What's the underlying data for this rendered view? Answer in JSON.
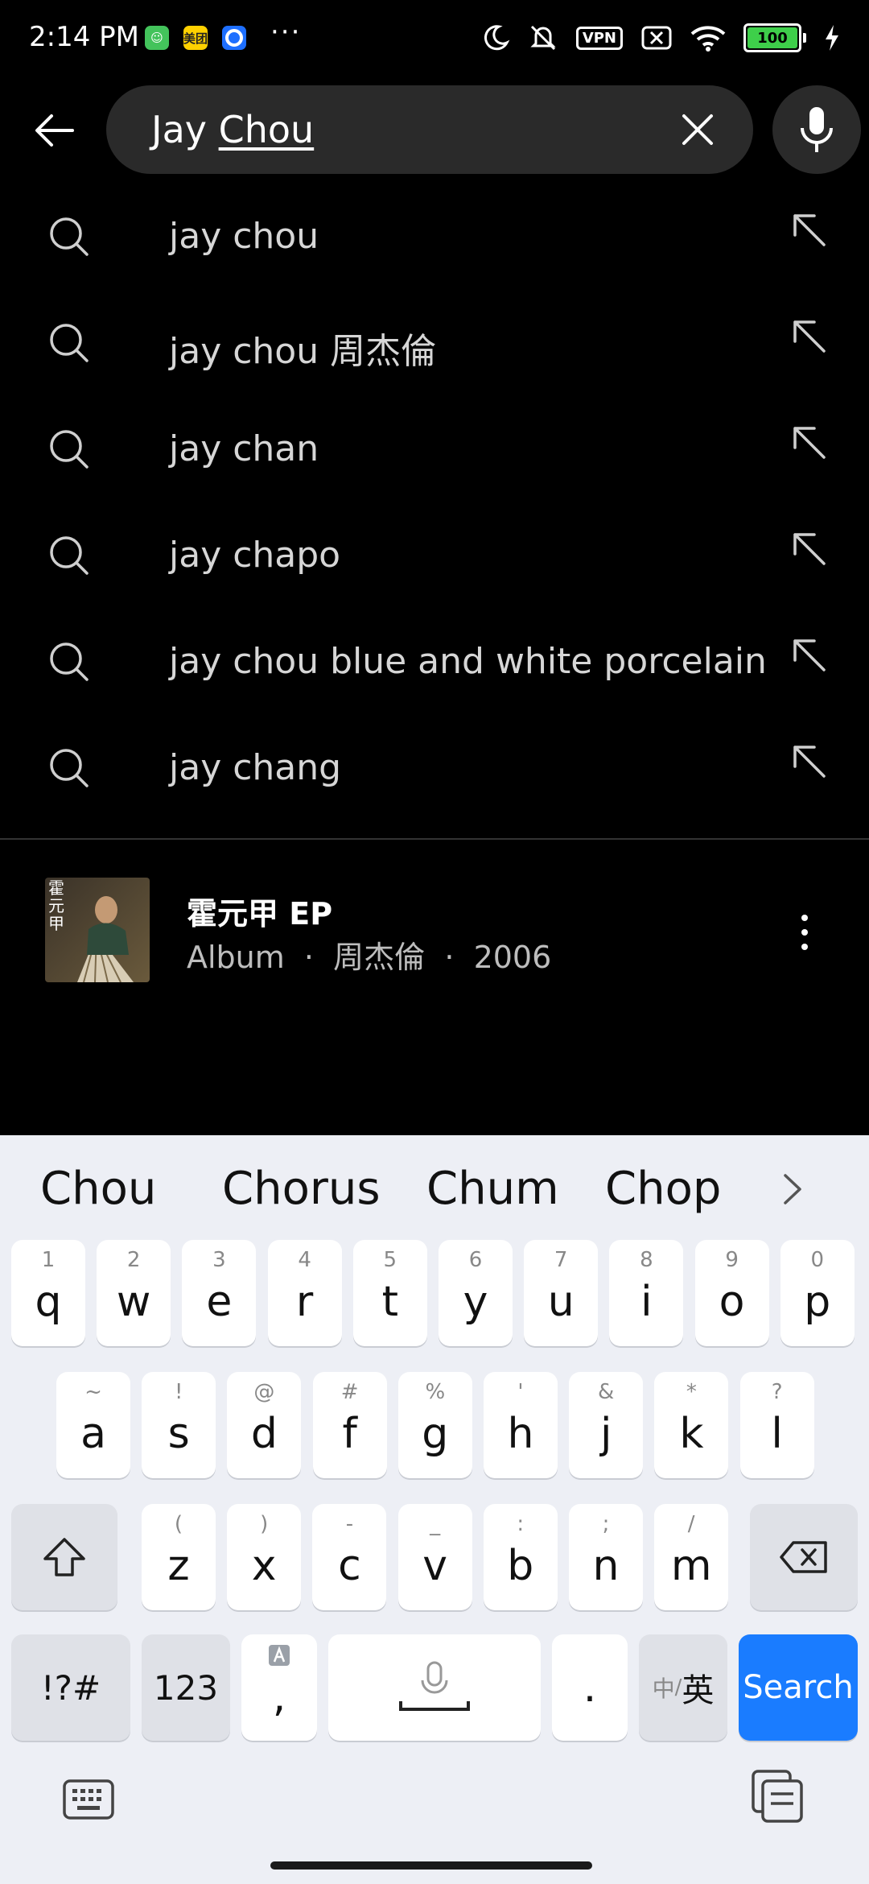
{
  "status_bar": {
    "time": "2:14 PM",
    "badges": [
      {
        "icon": "green-app-icon",
        "text": "",
        "color": "#43c35b"
      },
      {
        "icon": "meituan-icon",
        "text": "美团",
        "color": "#ffd100"
      },
      {
        "icon": "blue-app-icon",
        "text": "",
        "color": "#1e6fff"
      }
    ],
    "more_dots": "···",
    "vpn_label": "VPN",
    "battery_level": "100"
  },
  "search": {
    "query_prefix": "Jay ",
    "query_composing": "Chou"
  },
  "suggestions": [
    {
      "text": "jay chou"
    },
    {
      "text": "jay chou 周杰倫"
    },
    {
      "text": "jay chan"
    },
    {
      "text": "jay chapo"
    },
    {
      "text": "jay chou blue and white porcelain"
    },
    {
      "text": "jay chang"
    }
  ],
  "album_result": {
    "art_text": "霍元甲",
    "title": "霍元甲 EP",
    "subtitle": "Album  ·  周杰倫  ·  2006"
  },
  "keyboard": {
    "candidates": [
      "Chou",
      "Chorus",
      "Chum",
      "Chop"
    ],
    "row1": [
      {
        "k": "q",
        "h": "1"
      },
      {
        "k": "w",
        "h": "2"
      },
      {
        "k": "e",
        "h": "3"
      },
      {
        "k": "r",
        "h": "4"
      },
      {
        "k": "t",
        "h": "5"
      },
      {
        "k": "y",
        "h": "6"
      },
      {
        "k": "u",
        "h": "7"
      },
      {
        "k": "i",
        "h": "8"
      },
      {
        "k": "o",
        "h": "9"
      },
      {
        "k": "p",
        "h": "0"
      }
    ],
    "row2": [
      {
        "k": "a",
        "h": "~"
      },
      {
        "k": "s",
        "h": "!"
      },
      {
        "k": "d",
        "h": "@"
      },
      {
        "k": "f",
        "h": "#"
      },
      {
        "k": "g",
        "h": "%"
      },
      {
        "k": "h",
        "h": "'"
      },
      {
        "k": "j",
        "h": "&"
      },
      {
        "k": "k",
        "h": "*"
      },
      {
        "k": "l",
        "h": "?"
      }
    ],
    "row3": [
      {
        "k": "z",
        "h": "("
      },
      {
        "k": "x",
        "h": ")"
      },
      {
        "k": "c",
        "h": "-"
      },
      {
        "k": "v",
        "h": "_"
      },
      {
        "k": "b",
        "h": ":"
      },
      {
        "k": "n",
        "h": ";"
      },
      {
        "k": "m",
        "h": "/"
      }
    ],
    "symbols_label": "!?#",
    "numbers_label": "123",
    "comma_label": ",",
    "period_label": ".",
    "lang_small": "中",
    "lang_big": "英",
    "search_label": "Search",
    "accent_color": "#1a7cff"
  }
}
